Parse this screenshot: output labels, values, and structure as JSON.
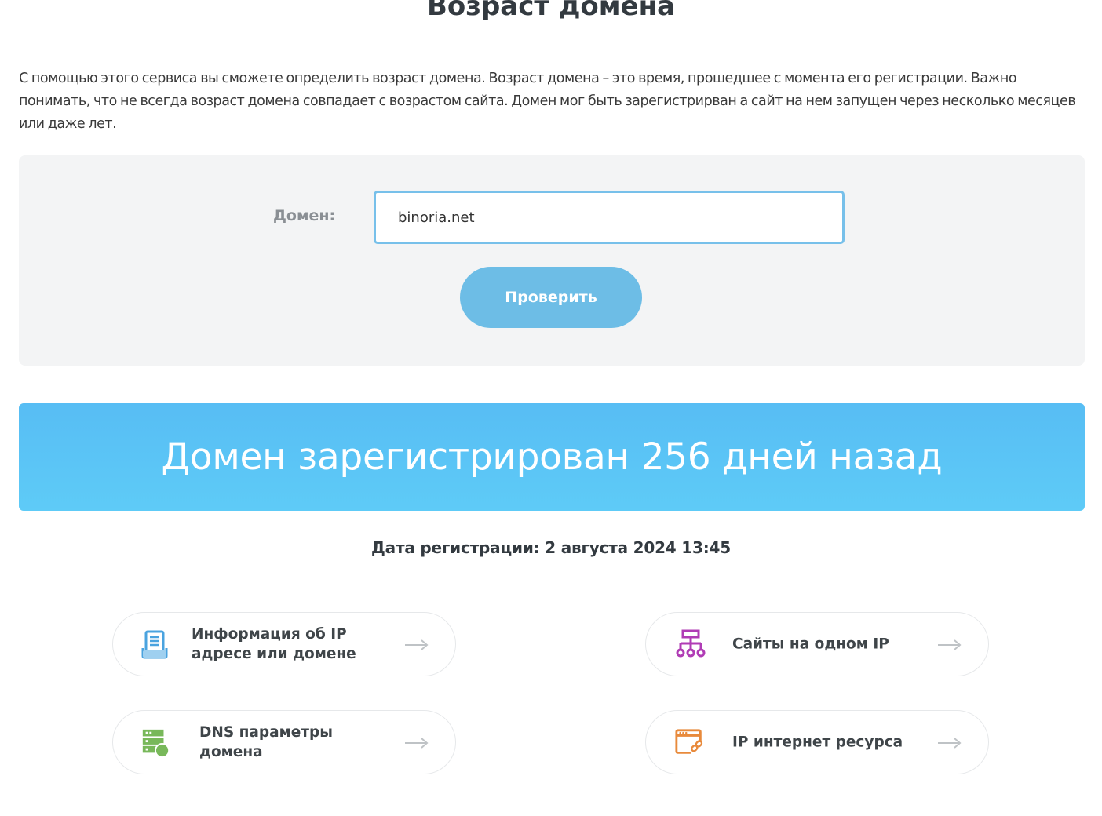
{
  "page": {
    "title": "Возраст домена",
    "intro": "С помощью этого сервиса вы сможете определить возраст домена. Возраст домена – это время, прошедшее с момента его регистрации. Важно понимать, что не всегда возраст домена совпадает с возрастом сайта. Домен мог быть зарегистрирван а сайт на нем запущен через несколько месяцев или даже лет."
  },
  "form": {
    "domain_label": "Домен:",
    "domain_value": "binoria.net",
    "submit_label": "Проверить"
  },
  "result": {
    "banner_text": "Домен зарегистрирован 256 дней назад",
    "registration_date": "Дата регистрации: 2 августа 2024 13:45"
  },
  "links": [
    {
      "label": "Информация об IP адресе или домене",
      "icon": "document-stack-icon",
      "icon_color": "#4aa3df"
    },
    {
      "label": "Сайты на одном IP",
      "icon": "network-tree-icon",
      "icon_color": "#b03cb5"
    },
    {
      "label": "DNS параметры домена",
      "icon": "server-dns-icon",
      "icon_color": "#78b85a"
    },
    {
      "label": "IP интернет ресурса",
      "icon": "browser-link-icon",
      "icon_color": "#e88a3c"
    }
  ],
  "colors": {
    "accent": "#6dbde6",
    "banner": "#5ac5f5",
    "input_border": "#77c0ea",
    "panel_bg": "#f3f4f5"
  }
}
